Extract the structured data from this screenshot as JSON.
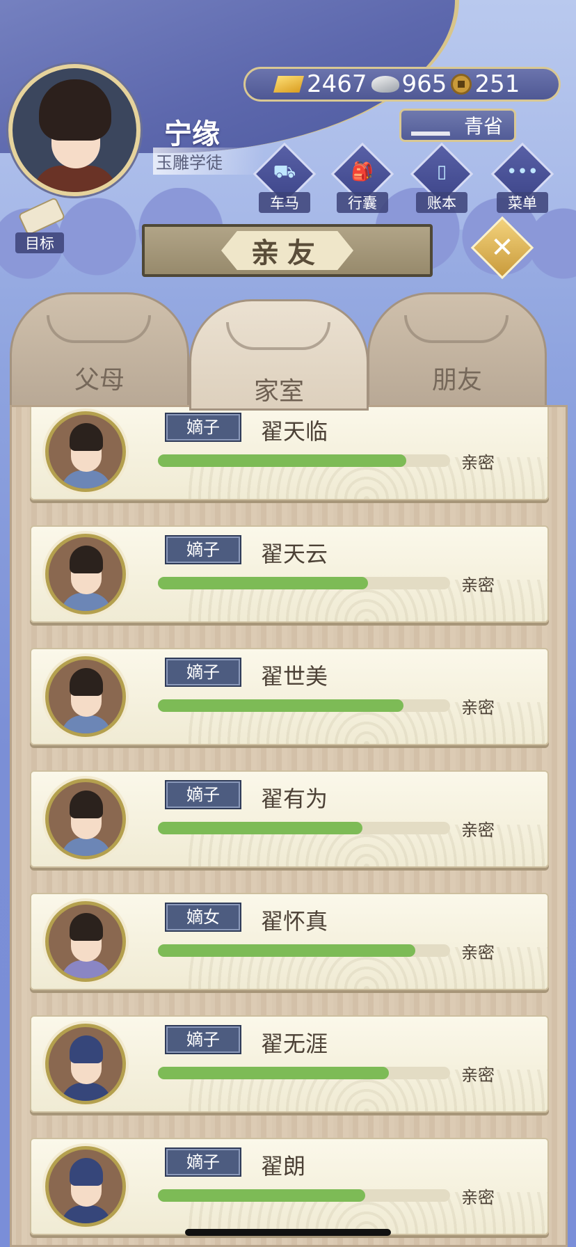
{
  "colors": {
    "accent_gold": "#d9c893",
    "bar_green": "#7dbb56",
    "rank_badge": "#4d5c80",
    "panel_wood": "#d9c8b1"
  },
  "player": {
    "name": "宁缘",
    "title": "玉雕学徒",
    "avatar_icon": "player-portrait"
  },
  "currency": {
    "gold": "2467",
    "silver": "965",
    "coins": "251"
  },
  "region": {
    "label": "青省",
    "icon": "ink-brush-icon"
  },
  "menu": [
    {
      "label": "车马",
      "icon": "carriage-icon",
      "glyph": "⛟"
    },
    {
      "label": "行囊",
      "icon": "bag-icon",
      "glyph": "🎒"
    },
    {
      "label": "账本",
      "icon": "ledger-icon",
      "glyph": "▯"
    },
    {
      "label": "菜单",
      "icon": "more-icon",
      "glyph": "•••"
    }
  ],
  "goal": {
    "label": "目标",
    "icon": "scroll-icon"
  },
  "section": {
    "title": "亲友",
    "close_glyph": "✕"
  },
  "tabs": [
    {
      "label": "父母",
      "active": false
    },
    {
      "label": "家室",
      "active": true
    },
    {
      "label": "朋友",
      "active": false
    }
  ],
  "relatives": [
    {
      "rank": "嫡子",
      "name": "翟天临",
      "relation": "亲密",
      "progress": 0.85
    },
    {
      "rank": "嫡子",
      "name": "翟天云",
      "relation": "亲密",
      "progress": 0.72
    },
    {
      "rank": "嫡子",
      "name": "翟世美",
      "relation": "亲密",
      "progress": 0.84
    },
    {
      "rank": "嫡子",
      "name": "翟有为",
      "relation": "亲密",
      "progress": 0.7
    },
    {
      "rank": "嫡女",
      "name": "翟怀真",
      "relation": "亲密",
      "progress": 0.88
    },
    {
      "rank": "嫡子",
      "name": "翟无涯",
      "relation": "亲密",
      "progress": 0.79
    },
    {
      "rank": "嫡子",
      "name": "翟朗",
      "relation": "亲密",
      "progress": 0.71
    }
  ]
}
